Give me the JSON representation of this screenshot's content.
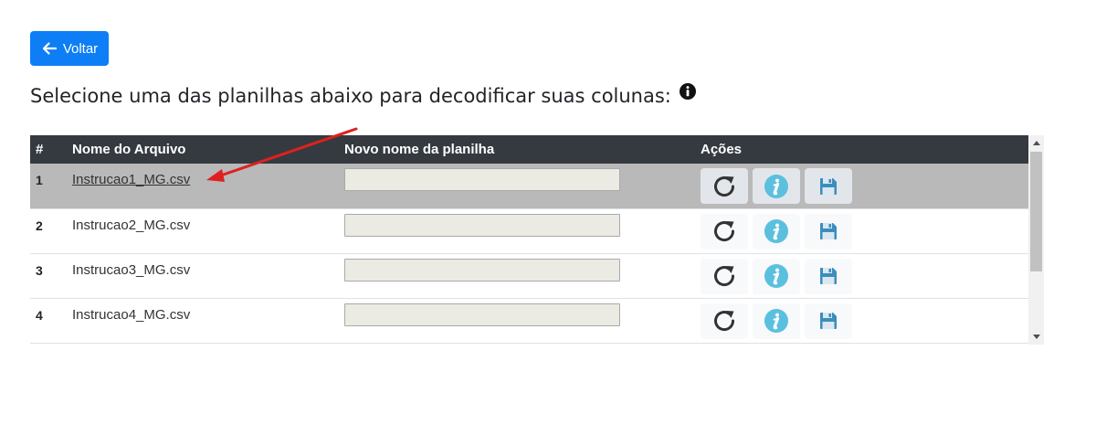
{
  "back_button": {
    "label": "Voltar",
    "icon": "arrow-left-icon"
  },
  "heading": {
    "text": "Selecione uma das planilhas abaixo para decodificar suas colunas:",
    "icon": "info-circle-icon"
  },
  "table": {
    "columns": [
      "#",
      "Nome do Arquivo",
      "Novo nome da planilha",
      "Ações"
    ],
    "rows": [
      {
        "num": "1",
        "file": "Instrucao1_MG.csv",
        "new_name": "",
        "selected": true
      },
      {
        "num": "2",
        "file": "Instrucao2_MG.csv",
        "new_name": "",
        "selected": false
      },
      {
        "num": "3",
        "file": "Instrucao3_MG.csv",
        "new_name": "",
        "selected": false
      },
      {
        "num": "4",
        "file": "Instrucao4_MG.csv",
        "new_name": "",
        "selected": false
      }
    ],
    "action_icons": [
      "refresh-icon",
      "info-icon",
      "save-icon"
    ]
  },
  "colors": {
    "primary": "#0d7ef5",
    "header_bg": "#343a40",
    "selected_row": "#b9b9b9",
    "info_icon": "#5bc0de",
    "save_icon": "#3c8dbc",
    "annotation_arrow": "#e02020"
  }
}
